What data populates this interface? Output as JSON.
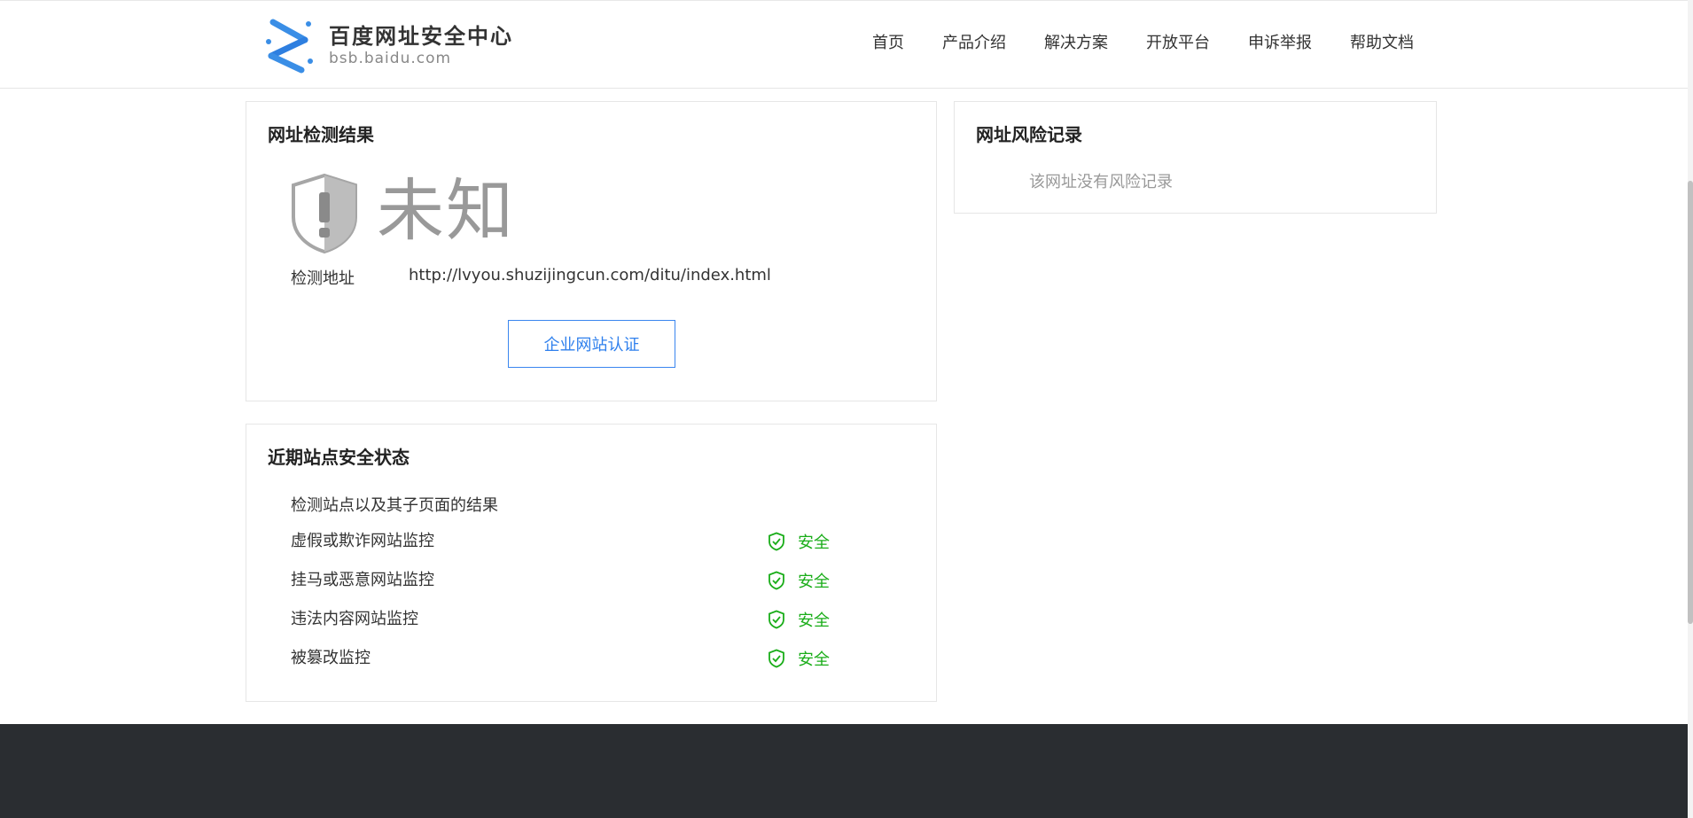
{
  "brand": {
    "title": "百度网址安全中心",
    "subtitle": "bsb.baidu.com"
  },
  "nav": [
    "首页",
    "产品介绍",
    "解决方案",
    "开放平台",
    "申诉举报",
    "帮助文档"
  ],
  "result_panel": {
    "title": "网址检测结果",
    "status": "未知",
    "address_label": "检测地址",
    "address_value": "http://lvyou.shuzijingcun.com/ditu/index.html",
    "cert_button": "企业网站认证"
  },
  "risk_panel": {
    "title": "网址风险记录",
    "empty_text": "该网址没有风险记录"
  },
  "status_panel": {
    "title": "近期站点安全状态",
    "description": "检测站点以及其子页面的结果",
    "checks": [
      {
        "label": "虚假或欺诈网站监控",
        "state": "安全"
      },
      {
        "label": "挂马或恶意网站监控",
        "state": "安全"
      },
      {
        "label": "违法内容网站监控",
        "state": "安全"
      },
      {
        "label": "被篡改监控",
        "state": "安全"
      }
    ]
  },
  "colors": {
    "accent": "#2f80ed",
    "safe": "#1aad19",
    "unknown": "#999999",
    "footer": "#2a2d31"
  }
}
